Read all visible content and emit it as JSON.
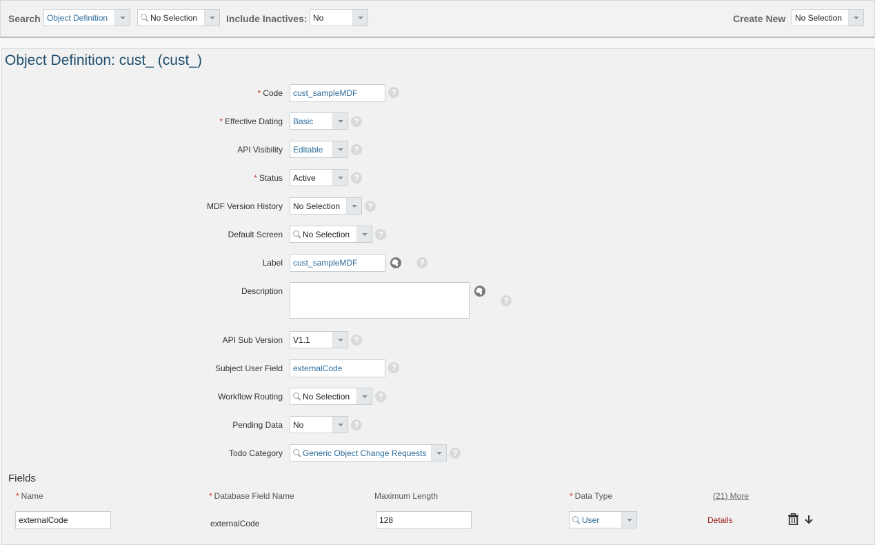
{
  "topbar": {
    "search_label": "Search",
    "search_type": "Object Definition",
    "search_value": "No Selection",
    "include_inactives_label": "Include Inactives:",
    "include_inactives_value": "No",
    "create_new_label": "Create New",
    "create_new_value": "No Selection"
  },
  "page_title": "Object Definition: cust_ (cust_)",
  "form": {
    "code": {
      "label": "Code",
      "required": true,
      "value": "cust_sampleMDF"
    },
    "effective_dating": {
      "label": "Effective Dating",
      "required": true,
      "value": "Basic"
    },
    "api_visibility": {
      "label": "API Visibility",
      "required": false,
      "value": "Editable"
    },
    "status": {
      "label": "Status",
      "required": true,
      "value": "Active"
    },
    "mdf_version_history": {
      "label": "MDF Version History",
      "required": false,
      "value": "No Selection"
    },
    "default_screen": {
      "label": "Default Screen",
      "required": false,
      "value": "No Selection"
    },
    "label": {
      "label": "Label",
      "required": false,
      "value": "cust_sampleMDF"
    },
    "description": {
      "label": "Description",
      "required": false,
      "value": ""
    },
    "api_sub_version": {
      "label": "API Sub Version",
      "required": false,
      "value": "V1.1"
    },
    "subject_user_field": {
      "label": "Subject User Field",
      "required": false,
      "value": "externalCode"
    },
    "workflow_routing": {
      "label": "Workflow Routing",
      "required": false,
      "value": "No Selection"
    },
    "pending_data": {
      "label": "Pending Data",
      "required": false,
      "value": "No"
    },
    "todo_category": {
      "label": "Todo Category",
      "required": false,
      "value": "Generic Object Change Requests"
    }
  },
  "required_marker": "*",
  "help_glyph": "?",
  "fields": {
    "title": "Fields",
    "columns": {
      "name": "Name",
      "database_field_name": "Database Field Name",
      "maximum_length": "Maximum Length",
      "data_type": "Data Type",
      "more": "(21) More"
    },
    "rows": [
      {
        "name": "externalCode",
        "database_field_name": "externalCode",
        "maximum_length": "128",
        "data_type": "User",
        "details": "Details"
      }
    ]
  },
  "icons": {
    "help": "question-circle",
    "translate": "globe",
    "search": "magnifier",
    "delete": "trash",
    "move_down": "arrow-down"
  }
}
